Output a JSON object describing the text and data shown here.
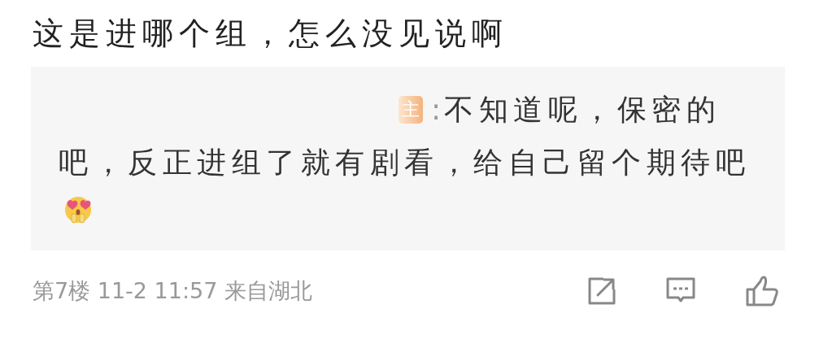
{
  "post": {
    "text": "这是进哪个组，怎么没见说啊"
  },
  "reply": {
    "badge": "主",
    "separator": ":",
    "lines": [
      "不知道呢，保密的",
      "吧，反正进组了就有剧看，给自己留个期待吧"
    ]
  },
  "footer": {
    "meta": "第7楼 11-2 11:57 来自湖北"
  }
}
